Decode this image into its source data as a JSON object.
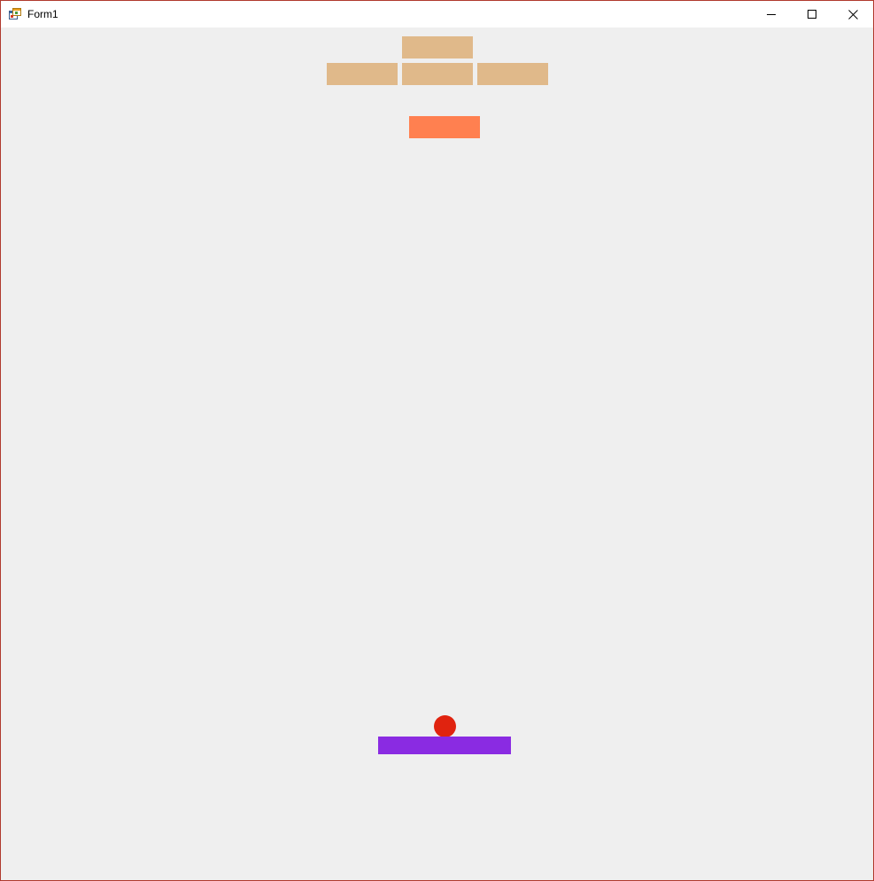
{
  "window": {
    "title": "Form1",
    "border_color": "#b03a2e"
  },
  "titlebar": {
    "app_icon": "winforms-app-icon",
    "minimize_icon": "minimize-icon",
    "maximize_icon": "maximize-icon",
    "close_icon": "close-icon"
  },
  "game": {
    "background_color": "#efefef",
    "bricks": [
      {
        "id": "brick-top",
        "color": "#e0b98a"
      },
      {
        "id": "brick-row2-left",
        "color": "#e0b98a"
      },
      {
        "id": "brick-row2-middle",
        "color": "#e0b98a"
      },
      {
        "id": "brick-row2-right",
        "color": "#e0b98a"
      },
      {
        "id": "brick-coral",
        "color": "#ff8050"
      }
    ],
    "ball": {
      "color": "#e0230f"
    },
    "paddle": {
      "color": "#8a2be2"
    }
  }
}
